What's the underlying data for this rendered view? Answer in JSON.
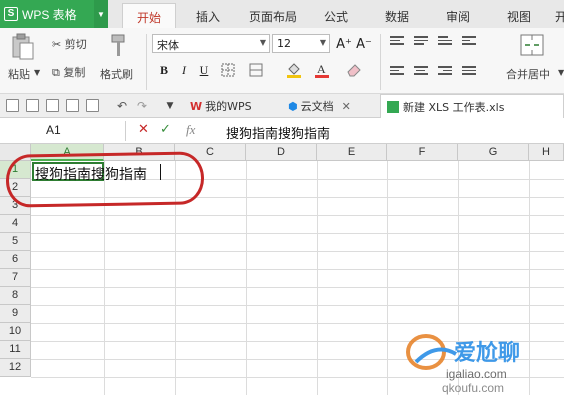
{
  "app": {
    "name": "WPS 表格",
    "logo_letter": "S"
  },
  "ribbon_tabs": [
    "开始",
    "插入",
    "页面布局",
    "公式",
    "数据",
    "审阅",
    "视图",
    "开"
  ],
  "clipboard": {
    "paste": "粘贴",
    "cut": "剪切",
    "copy": "复制",
    "format_painter": "格式刷"
  },
  "font": {
    "family": "宋体",
    "size": "12",
    "grow": "A⁺",
    "shrink": "A⁻",
    "bold": "B",
    "italic": "I",
    "underline": "U"
  },
  "alignment": {
    "merge_center": "合并居中"
  },
  "document_tabs": [
    {
      "label": "我的WPS"
    },
    {
      "label": "云文档"
    },
    {
      "label": "新建 XLS 工作表.xls"
    }
  ],
  "formula_bar": {
    "cell_ref": "A1",
    "cancel": "✕",
    "confirm": "✓",
    "fx": "fx",
    "content": "搜狗指南搜狗指南"
  },
  "columns": [
    "A",
    "B",
    "C",
    "D",
    "E",
    "F",
    "G",
    "H"
  ],
  "rows": [
    "1",
    "2",
    "3",
    "4",
    "5",
    "6",
    "7",
    "8",
    "9",
    "10",
    "11",
    "12"
  ],
  "cells": {
    "A1": "搜狗指南搜狗指南"
  },
  "watermark": {
    "line1": "爱尬聊",
    "line2": "igaliao.com",
    "line3": "qkoufu.com"
  },
  "colors": {
    "accent_green": "#34a853",
    "active_tab_text": "#c0392b",
    "annotation_red": "#c62828"
  }
}
